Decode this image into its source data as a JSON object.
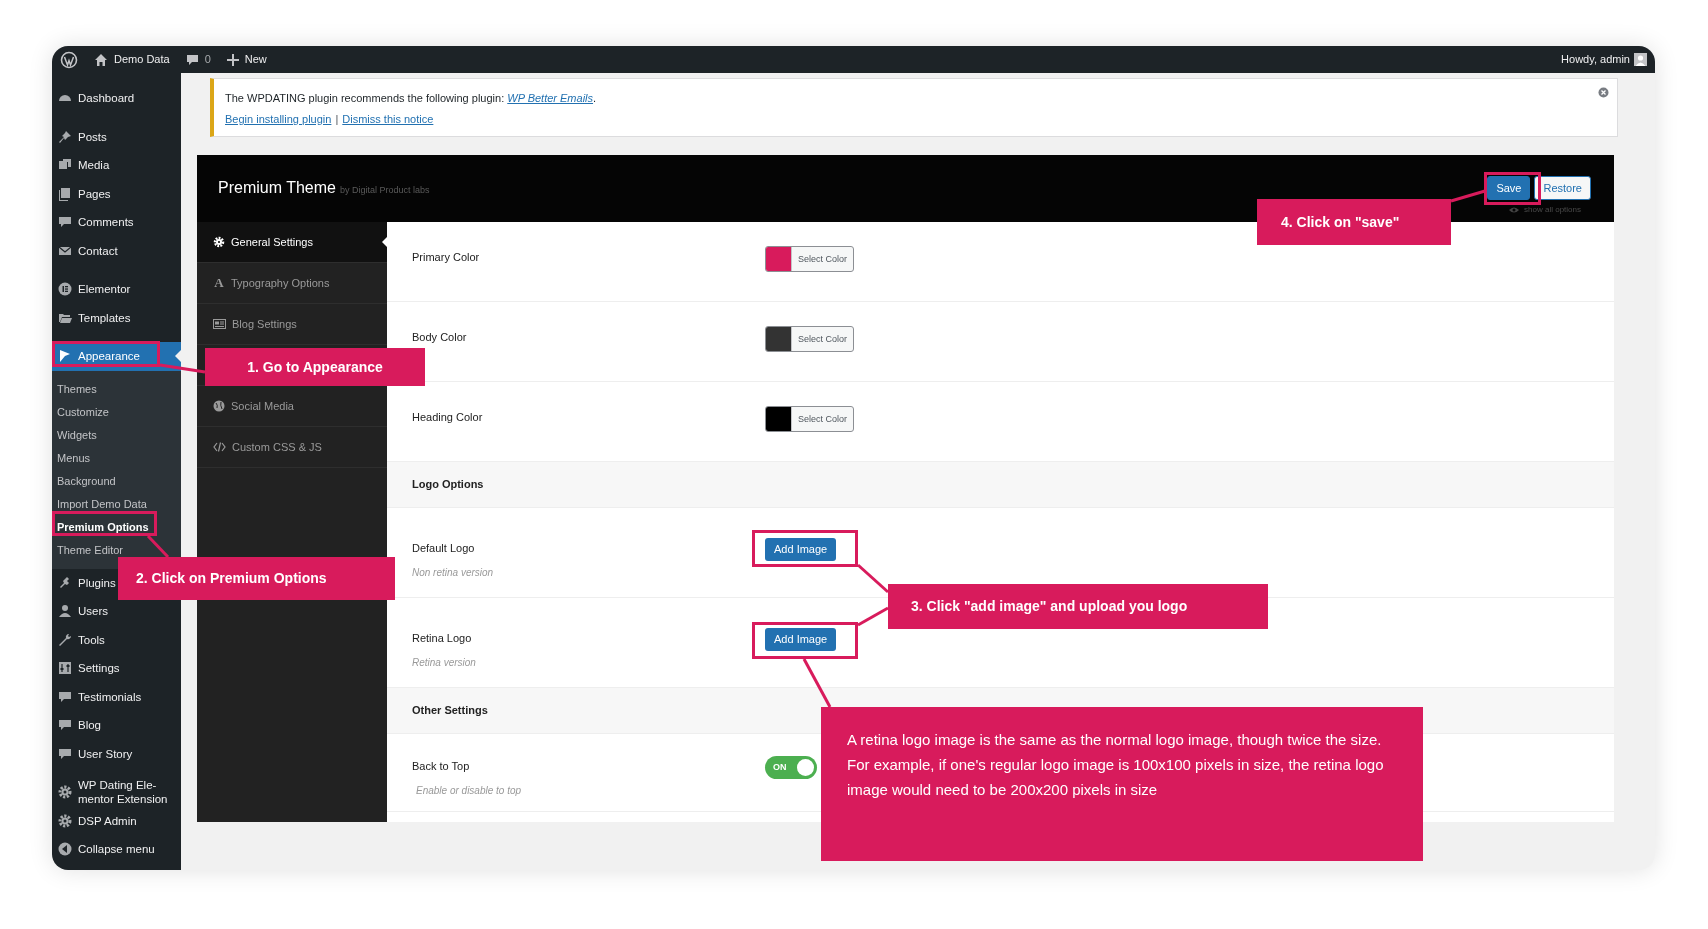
{
  "admin_bar": {
    "site": "Demo Data",
    "comments": "0",
    "new": "New",
    "greeting": "Howdy, admin"
  },
  "sidebar": {
    "groups": [
      {
        "items": [
          {
            "label": "Dashboard",
            "selected": false
          }
        ]
      },
      {
        "items": [
          {
            "label": "Posts",
            "selected": false
          },
          {
            "label": "Media",
            "selected": false
          },
          {
            "label": "Pages",
            "selected": false
          },
          {
            "label": "Comments",
            "selected": false
          },
          {
            "label": "Contact",
            "selected": false
          }
        ]
      },
      {
        "items": [
          {
            "label": "Elementor",
            "selected": false
          },
          {
            "label": "Templates",
            "selected": false
          }
        ]
      },
      {
        "items": [
          {
            "label": "Appearance",
            "selected": true,
            "children": [
              {
                "label": "Themes",
                "selected": false
              },
              {
                "label": "Customize",
                "selected": false
              },
              {
                "label": "Widgets",
                "selected": false
              },
              {
                "label": "Menus",
                "selected": false
              },
              {
                "label": "Background",
                "selected": false
              },
              {
                "label": "Import Demo Data",
                "selected": false
              },
              {
                "label": "Premium Options",
                "selected": true
              },
              {
                "label": "Theme Editor",
                "selected": false
              }
            ]
          },
          {
            "label": "Plugins",
            "selected": false
          },
          {
            "label": "Users",
            "selected": false
          },
          {
            "label": "Tools",
            "selected": false
          },
          {
            "label": "Settings",
            "selected": false
          },
          {
            "label": "Testimonials",
            "selected": false
          },
          {
            "label": "Blog",
            "selected": false
          },
          {
            "label": "User Story",
            "selected": false
          }
        ]
      },
      {
        "items": [
          {
            "label": "WP Dating Ele-mentor Extension",
            "selected": false
          },
          {
            "label": "DSP Admin",
            "selected": false
          },
          {
            "label": "Collapse menu",
            "selected": false
          }
        ]
      }
    ]
  },
  "notice": {
    "message": "The WPDATING plugin recommends the following plugin: ",
    "plugin_link": "WP Better Emails",
    "message_end": ".",
    "actions": [
      "Begin installing plugin",
      "Dismiss this notice"
    ],
    "separator": "|"
  },
  "panel": {
    "title": "Premium Theme",
    "byline": "by Digital Product labs",
    "buttons": [
      {
        "label": "Save",
        "kind": "primary"
      },
      {
        "label": "Restore",
        "kind": "secondary"
      }
    ],
    "show_all": "show all options",
    "tabs": [
      {
        "label": "General Settings",
        "selected": true
      },
      {
        "label": "Typography Options",
        "selected": false,
        "icon_text": "A"
      },
      {
        "label": "Blog Settings",
        "selected": false
      },
      {
        "label": "Social Media",
        "selected": false,
        "gap_before": true
      },
      {
        "label": "Custom CSS & JS",
        "selected": false
      }
    ],
    "rows": [
      {
        "kind": "color",
        "label": "Primary Color",
        "color": "#d81b5c",
        "button": "Select Color"
      },
      {
        "kind": "color",
        "label": "Body Color",
        "color": "#333333",
        "button": "Select Color"
      },
      {
        "kind": "color",
        "label": "Heading Color",
        "color": "#000000",
        "button": "Select Color"
      },
      {
        "kind": "heading",
        "label": "Logo Options"
      },
      {
        "kind": "image",
        "label": "Default Logo",
        "hint": "Non retina version",
        "button": "Add Image"
      },
      {
        "kind": "image",
        "label": "Retina Logo",
        "hint": "Retina version",
        "button": "Add Image"
      },
      {
        "kind": "heading",
        "label": "Other Settings"
      },
      {
        "kind": "toggle",
        "label": "Back to Top",
        "hint": "Enable or disable to top",
        "on": true,
        "state_label": "ON"
      }
    ]
  },
  "annotations": [
    {
      "text": "1. Go to Appearance"
    },
    {
      "text": "2. Click on Premium Options"
    },
    {
      "text": "3. Click \"add image\" and upload you logo"
    },
    {
      "text": "4. Click on \"save\""
    },
    {
      "text": "A retina logo image is the same as the normal logo image, though twice the size. For example, if one's regular logo image is 100x100 pixels in size, the retina logo image would need to be 200x200 pixels in size"
    }
  ]
}
